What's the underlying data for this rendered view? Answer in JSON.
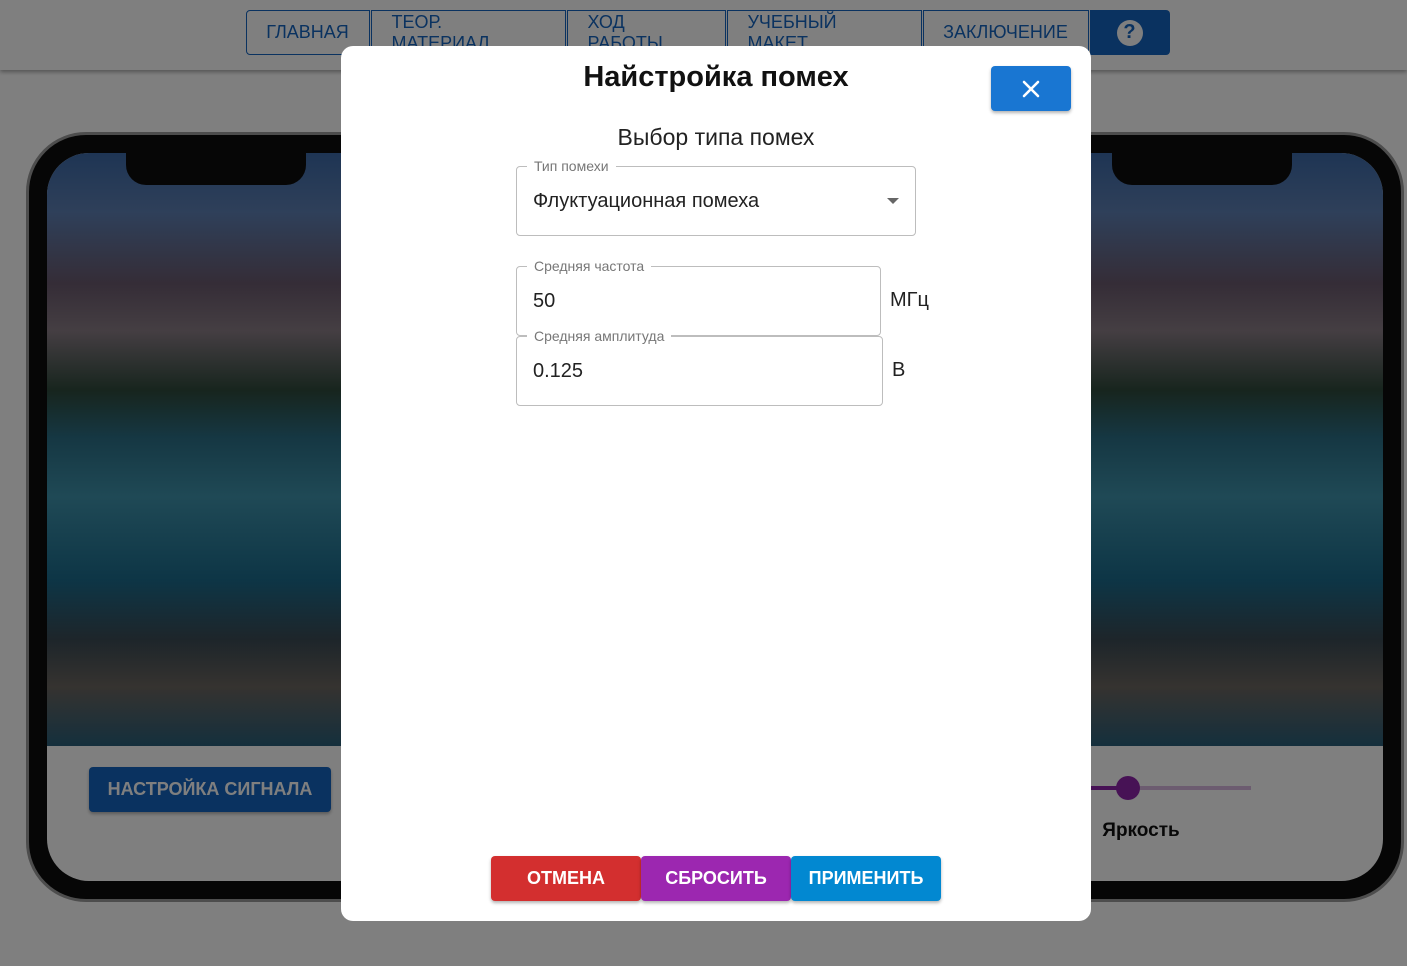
{
  "nav": {
    "items": [
      "ГЛАВНАЯ",
      "ТЕОР. МАТЕРИАЛ",
      "ХОД РАБОТЫ",
      "УЧЕБНЫЙ МАКЕТ",
      "ЗАКЛЮЧЕНИЕ"
    ],
    "help_glyph": "?"
  },
  "left_phone": {
    "button_label": "НАСТРОЙКА СИГНАЛА"
  },
  "right_phone": {
    "slider_label": "Яркость",
    "slider_value": 0.45
  },
  "modal": {
    "title": "Найстройка помех",
    "close_icon": "close-icon",
    "subtitle": "Выбор типа помех",
    "noise_type": {
      "label": "Тип помехи",
      "value": "Флуктуационная помеха"
    },
    "frequency": {
      "label": "Средняя частота",
      "value": "50",
      "unit": "МГц"
    },
    "amplitude": {
      "label": "Средняя амплитуда",
      "value": "0.125",
      "unit": "В"
    },
    "buttons": {
      "cancel": "ОТМЕНА",
      "reset": "СБРОСИТЬ",
      "apply": "ПРИМЕНИТЬ"
    }
  },
  "colors": {
    "primary": "#1565c0",
    "cancel": "#d32f2f",
    "reset": "#9c27b0",
    "apply": "#0288d1",
    "slider": "#8e24aa"
  }
}
